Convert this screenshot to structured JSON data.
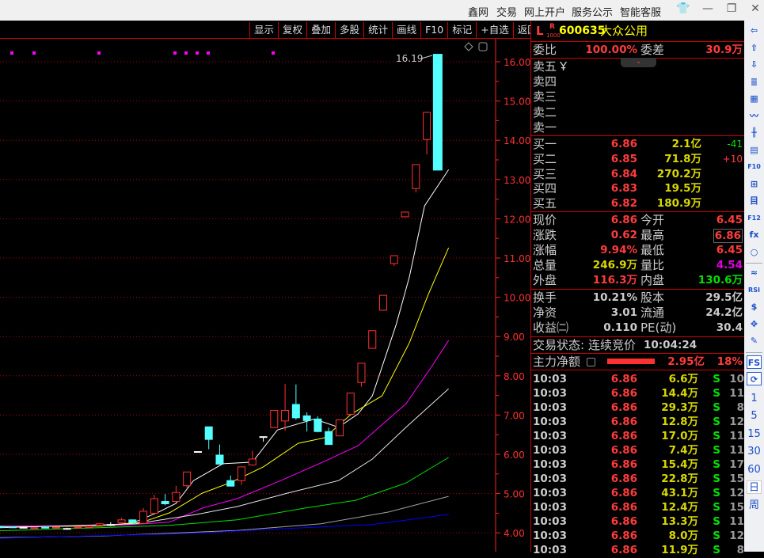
{
  "titlebar": {
    "menu": [
      "鑫网",
      "交易",
      "网上开户",
      "服务公示",
      "智能客服"
    ],
    "icons": [
      "shirt-icon",
      "minimize-icon",
      "restore-icon",
      "close-icon"
    ],
    "glyphs": [
      "👕",
      "—",
      "❐",
      "✕"
    ]
  },
  "toolbar": [
    "显示",
    "复权",
    "叠加",
    "多股",
    "统计",
    "画线",
    "F10",
    "标记",
    "+自选",
    "返回"
  ],
  "chart": {
    "axis_labels": [
      "16.00",
      "15.00",
      "14.00",
      "13.00",
      "12.00",
      "11.00",
      "10.00",
      "9.00",
      "8.00",
      "7.00",
      "6.00",
      "5.00",
      "4.00"
    ],
    "high_label": "16.19",
    "colors": {
      "up": "#ff3232",
      "down": "#54ffff",
      "doji": "#ffffff",
      "grid": "#b00000",
      "axis": "#ff2020"
    },
    "chart_data": {
      "type": "candlestick",
      "ylim": [
        3.7,
        16.4
      ],
      "candles_ohlc": [
        [
          4.16,
          4.18,
          4.14,
          4.15
        ],
        [
          4.15,
          4.16,
          4.12,
          4.13
        ],
        [
          4.14,
          4.15,
          4.12,
          4.14
        ],
        [
          4.12,
          4.14,
          4.11,
          4.13
        ],
        [
          4.14,
          4.15,
          4.12,
          4.12
        ],
        [
          4.12,
          4.15,
          4.11,
          4.14
        ],
        [
          4.11,
          4.13,
          4.1,
          4.11
        ],
        [
          4.13,
          4.15,
          4.12,
          4.14
        ],
        [
          4.14,
          4.17,
          4.13,
          4.17
        ],
        [
          4.19,
          4.25,
          4.18,
          4.23
        ],
        [
          4.21,
          4.27,
          4.17,
          4.21
        ],
        [
          4.26,
          4.38,
          4.25,
          4.33
        ],
        [
          4.33,
          4.34,
          4.25,
          4.26
        ],
        [
          4.24,
          4.63,
          4.22,
          4.55
        ],
        [
          4.5,
          4.97,
          4.48,
          4.87
        ],
        [
          4.8,
          4.99,
          4.7,
          4.74
        ],
        [
          4.8,
          5.2,
          4.78,
          5.03
        ],
        [
          5.2,
          5.55,
          5.12,
          5.55
        ],
        [
          6.07,
          6.07,
          6.07,
          6.07
        ],
        [
          6.7,
          6.7,
          6.13,
          6.38
        ],
        [
          5.98,
          6.25,
          5.75,
          5.75
        ],
        [
          5.33,
          5.46,
          5.19,
          5.19
        ],
        [
          5.33,
          5.68,
          5.22,
          5.68
        ],
        [
          5.73,
          6.09,
          5.72,
          5.88
        ],
        [
          6.45,
          6.45,
          6.32,
          6.45
        ],
        [
          6.68,
          7.12,
          6.68,
          7.12
        ],
        [
          6.85,
          7.79,
          6.6,
          7.12
        ],
        [
          7.27,
          7.78,
          6.88,
          6.93
        ],
        [
          6.98,
          7.07,
          6.58,
          6.86
        ],
        [
          6.9,
          6.97,
          6.56,
          6.58
        ],
        [
          6.58,
          6.68,
          6.25,
          6.25
        ],
        [
          6.47,
          6.88,
          6.47,
          6.88
        ],
        [
          7.02,
          7.56,
          7.02,
          7.56
        ],
        [
          7.83,
          8.32,
          7.72,
          8.32
        ],
        [
          8.7,
          9.15,
          8.7,
          9.15
        ],
        [
          9.67,
          10.05,
          9.67,
          10.05
        ],
        [
          10.86,
          11.06,
          10.8,
          11.06
        ],
        [
          12.05,
          12.17,
          12.05,
          12.17
        ],
        [
          12.77,
          13.38,
          12.67,
          13.38
        ],
        [
          14.02,
          14.71,
          13.64,
          14.71
        ],
        [
          16.19,
          16.19,
          13.24,
          13.24
        ]
      ],
      "moving_averages": [
        {
          "name": "MA5",
          "color": "#ffffff",
          "points": [
            [
              -0.2,
              4.15
            ],
            [
              9,
              4.18
            ],
            [
              12,
              4.25
            ],
            [
              14.4,
              4.53
            ],
            [
              16,
              4.75
            ],
            [
              17.6,
              5.33
            ],
            [
              20.3,
              5.76
            ],
            [
              23,
              5.8
            ],
            [
              25.3,
              6.62
            ],
            [
              28.7,
              6.9
            ],
            [
              30.9,
              6.69
            ],
            [
              32.7,
              7.03
            ],
            [
              34,
              7.49
            ],
            [
              36.2,
              9.31
            ],
            [
              37.4,
              10.52
            ],
            [
              38.8,
              12.33
            ],
            [
              41,
              13.25
            ]
          ]
        },
        {
          "name": "MA10",
          "color": "#ffff00",
          "points": [
            [
              -0.2,
              4.17
            ],
            [
              9.1,
              4.17
            ],
            [
              12.9,
              4.27
            ],
            [
              15.4,
              4.51
            ],
            [
              18.4,
              5.01
            ],
            [
              21,
              5.28
            ],
            [
              24,
              5.68
            ],
            [
              27.2,
              6.28
            ],
            [
              29.6,
              6.42
            ],
            [
              32.1,
              7.03
            ],
            [
              34.9,
              7.49
            ],
            [
              37.4,
              8.84
            ],
            [
              39.1,
              10.05
            ],
            [
              41,
              11.26
            ]
          ]
        },
        {
          "name": "MA20",
          "color": "#ff00ff",
          "points": [
            [
              -0.2,
              4.17
            ],
            [
              10.7,
              4.19
            ],
            [
              15.4,
              4.27
            ],
            [
              18.4,
              4.63
            ],
            [
              21.6,
              4.87
            ],
            [
              25.6,
              5.33
            ],
            [
              29.6,
              5.82
            ],
            [
              32.7,
              6.22
            ],
            [
              37.1,
              7.29
            ],
            [
              39.6,
              8.3
            ],
            [
              41,
              8.9
            ]
          ]
        },
        {
          "name": "MA30",
          "color": "#e8e8e8",
          "points": [
            [
              -0.2,
              4.13
            ],
            [
              12.3,
              4.23
            ],
            [
              17.9,
              4.47
            ],
            [
              21.6,
              4.67
            ],
            [
              26.2,
              5.01
            ],
            [
              30.9,
              5.33
            ],
            [
              34,
              5.88
            ],
            [
              37.1,
              6.69
            ],
            [
              41,
              7.67
            ]
          ]
        },
        {
          "name": "MA60",
          "color": "#00e000",
          "points": [
            [
              -0.2,
              4.05
            ],
            [
              15.4,
              4.19
            ],
            [
              21.6,
              4.33
            ],
            [
              27.8,
              4.63
            ],
            [
              32.5,
              4.83
            ],
            [
              37.1,
              5.27
            ],
            [
              41,
              5.92
            ]
          ]
        },
        {
          "name": "MA120",
          "color": "#a0a0a0",
          "points": [
            [
              -0.2,
              3.88
            ],
            [
              9.1,
              3.92
            ],
            [
              21.6,
              4.06
            ],
            [
              29.3,
              4.23
            ],
            [
              35.5,
              4.53
            ],
            [
              41,
              4.93
            ]
          ]
        },
        {
          "name": "MA250",
          "color": "#0000ff",
          "points": [
            [
              -0.2,
              3.86
            ],
            [
              4.5,
              3.9
            ],
            [
              16.9,
              3.98
            ],
            [
              26.2,
              4.11
            ],
            [
              34,
              4.21
            ],
            [
              41,
              4.47
            ]
          ]
        }
      ]
    }
  },
  "quote": {
    "flag": "L",
    "badge_top": "R",
    "badge_bottom": "1000",
    "code": "600635",
    "name": "大众公用",
    "weibi_label": "委比",
    "weibi": "100.00%",
    "weicha_label": "委差",
    "weicha": "30.9万",
    "sell": [
      {
        "label": "卖五",
        "extra": "Ұ"
      },
      {
        "label": "卖四"
      },
      {
        "label": "卖三"
      },
      {
        "label": "卖二"
      },
      {
        "label": "卖一"
      }
    ],
    "buy": [
      {
        "label": "买一",
        "price": "6.86",
        "vol": "2.1亿",
        "chg": "-41"
      },
      {
        "label": "买二",
        "price": "6.85",
        "vol": "71.8万",
        "chg": "+10"
      },
      {
        "label": "买三",
        "price": "6.84",
        "vol": "270.2万",
        "chg": ""
      },
      {
        "label": "买四",
        "price": "6.83",
        "vol": "19.5万",
        "chg": ""
      },
      {
        "label": "买五",
        "price": "6.82",
        "vol": "180.9万",
        "chg": ""
      }
    ],
    "stats1": [
      {
        "l1": "现价",
        "v1": "6.86",
        "c1": "red",
        "l2": "今开",
        "v2": "6.45",
        "c2": "red"
      },
      {
        "l1": "涨跌",
        "v1": "0.62",
        "c1": "red",
        "l2": "最高",
        "v2": "6.86",
        "c2": "red"
      },
      {
        "l1": "涨幅",
        "v1": "9.94%",
        "c1": "red",
        "l2": "最低",
        "v2": "6.45",
        "c2": "red"
      },
      {
        "l1": "总量",
        "v1": "246.9万",
        "c1": "yel",
        "l2": "量比",
        "v2": "4.54",
        "c2": "mag"
      },
      {
        "l1": "外盘",
        "v1": "116.3万",
        "c1": "red",
        "l2": "内盘",
        "v2": "130.6万",
        "c2": "grn"
      }
    ],
    "stats2": [
      {
        "l1": "换手",
        "v1": "10.21%",
        "l2": "股本",
        "v2": "29.5亿"
      },
      {
        "l1": "净资",
        "v1": "3.01",
        "l2": "流通",
        "v2": "24.2亿"
      },
      {
        "l1": "收益㈡",
        "v1": "0.110",
        "l2": "PE(动)",
        "v2": "30.4"
      }
    ],
    "status_label": "交易状态:",
    "status": "连续竞价",
    "status_time": "10:04:24",
    "mainflow_label": "主力净额",
    "mainflow": "2.95亿",
    "mainflow_pct": "18%",
    "mainflow_fill": 0.18,
    "trades": [
      [
        "10:03",
        "6.86",
        "6.6万",
        "S",
        "10"
      ],
      [
        "10:03",
        "6.86",
        "14.4万",
        "S",
        "11"
      ],
      [
        "10:03",
        "6.86",
        "29.3万",
        "S",
        "8"
      ],
      [
        "10:03",
        "6.86",
        "12.8万",
        "S",
        "12"
      ],
      [
        "10:03",
        "6.86",
        "17.0万",
        "S",
        "11"
      ],
      [
        "10:03",
        "6.86",
        "7.4万",
        "S",
        "11"
      ],
      [
        "10:03",
        "6.86",
        "15.4万",
        "S",
        "17"
      ],
      [
        "10:03",
        "6.86",
        "22.8万",
        "S",
        "15"
      ],
      [
        "10:03",
        "6.86",
        "43.1万",
        "S",
        "12"
      ],
      [
        "10:03",
        "6.86",
        "12.4万",
        "S",
        "15"
      ],
      [
        "10:03",
        "6.86",
        "13.3万",
        "S",
        "11"
      ],
      [
        "10:03",
        "6.86",
        "8.0万",
        "S",
        "12"
      ],
      [
        "10:03",
        "6.86",
        "11.9万",
        "S",
        "8"
      ]
    ]
  },
  "right_toolbar": {
    "icons": [
      [
        "back-arrow-icon",
        "⇦"
      ],
      [
        "up-arrow-icon",
        "⇧"
      ],
      [
        "down-arrow-icon",
        "⇩"
      ],
      [
        "quote-list-icon",
        "≣"
      ],
      [
        "multi-list-icon",
        "▦"
      ],
      [
        "line-chart-icon",
        "〰"
      ],
      [
        "kline-icon",
        "╫"
      ],
      [
        "news-icon",
        "▤"
      ],
      [
        "f10-icon",
        "F10"
      ],
      [
        "tree-icon",
        "⊞"
      ],
      [
        "notes-icon",
        "目"
      ],
      [
        "f12-icon",
        "F12"
      ],
      [
        "formula-icon",
        "fx"
      ],
      [
        "circle-icon",
        "○"
      ]
    ],
    "icons2": [
      [
        "indicator-icon",
        "≈"
      ],
      [
        "rsi-icon",
        "RSI"
      ],
      [
        "money-icon",
        "$"
      ],
      [
        "move-icon",
        "✥"
      ],
      [
        "pencil-icon",
        "✎"
      ]
    ],
    "icons3": [
      [
        "fs-icon",
        "FS"
      ],
      [
        "refresh-icon",
        "⟳"
      ]
    ],
    "periods": [
      "1",
      "5",
      "15",
      "30",
      "60",
      "日",
      "周"
    ]
  }
}
